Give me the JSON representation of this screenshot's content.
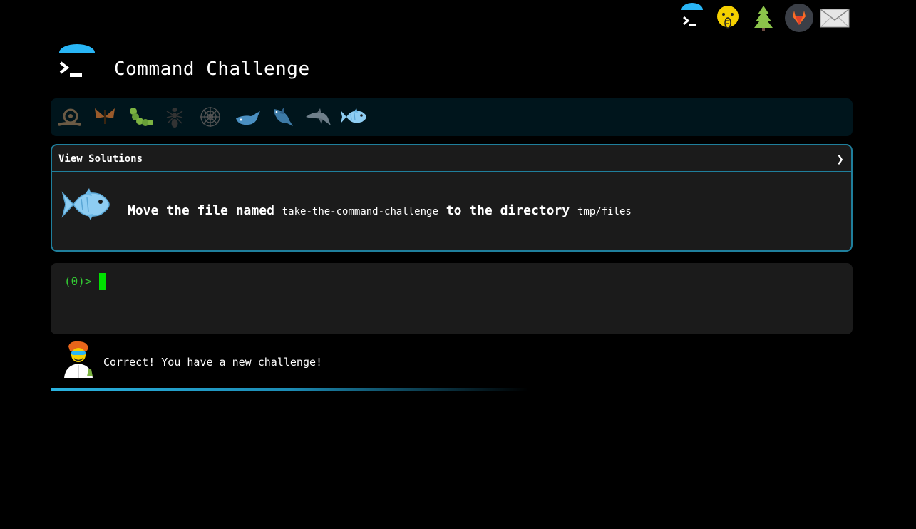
{
  "header": {
    "title": "Command Challenge"
  },
  "top_nav": [
    {
      "icon": "terminal-icon"
    },
    {
      "icon": "shushing-face-icon"
    },
    {
      "icon": "tree-icon"
    },
    {
      "icon": "gitlab-icon"
    },
    {
      "icon": "mail-icon"
    }
  ],
  "levels": [
    {
      "icon": "snail-icon"
    },
    {
      "icon": "butterfly-icon"
    },
    {
      "icon": "caterpillar-icon"
    },
    {
      "icon": "ant-icon"
    },
    {
      "icon": "spider-web-icon"
    },
    {
      "icon": "whale-icon"
    },
    {
      "icon": "shark-icon"
    },
    {
      "icon": "dolphin-icon"
    },
    {
      "icon": "fish-icon",
      "active": true
    }
  ],
  "panel": {
    "view_solutions": "View Solutions",
    "chevron": "❯",
    "task_prefix": "Move the file named",
    "file_name": "take-the-command-challenge",
    "task_middle": "to the directory",
    "directory": "tmp/files"
  },
  "terminal": {
    "prompt": "(0)>"
  },
  "status": {
    "message": "Correct! You have a new challenge!"
  },
  "colors": {
    "accent": "#1f7f9c",
    "prompt": "#33cc33",
    "panel_bg": "#1b1b1b",
    "levels_bg": "#00151c"
  }
}
